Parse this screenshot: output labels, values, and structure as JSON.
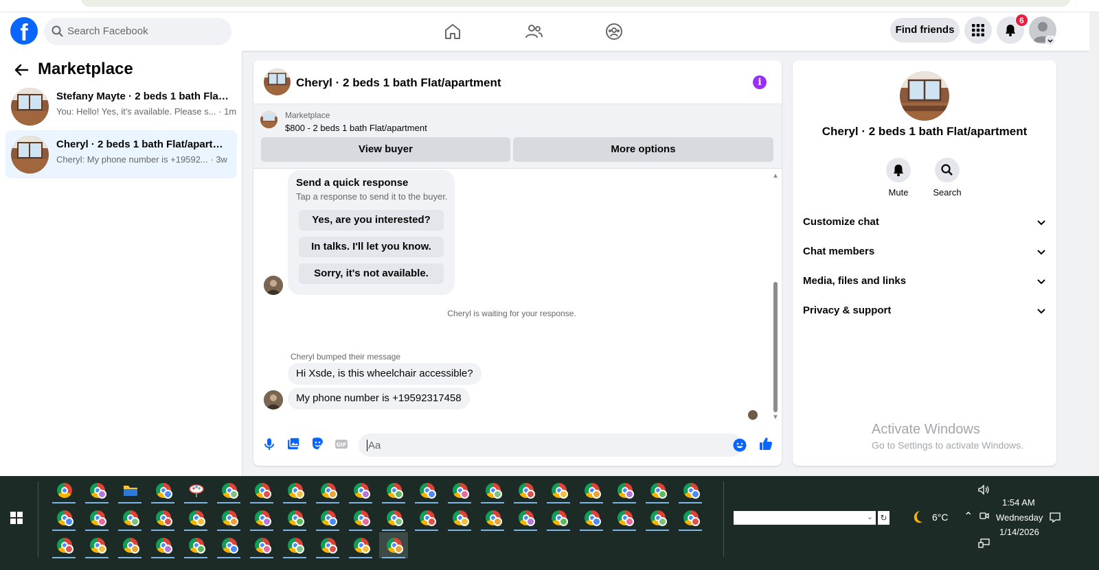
{
  "header": {
    "search_placeholder": "Search Facebook",
    "find_friends_label": "Find friends",
    "notification_count": "6",
    "fb_logo_letter": "f"
  },
  "sidebar": {
    "title": "Marketplace",
    "conversations": [
      {
        "title": "Stefany Mayte · 2 beds 1 bath Flat/...",
        "snippet": "You: Hello! Yes, it's available. Please s...",
        "time": "1m",
        "active": false
      },
      {
        "title": "Cheryl · 2 beds 1 bath Flat/apartm...",
        "snippet": "Cheryl: My phone number is +19592...",
        "time": "3w",
        "active": true
      }
    ]
  },
  "chat": {
    "title": "Cheryl · 2 beds 1 bath Flat/apartment",
    "info_glyph": "i",
    "marketplace_label": "Marketplace",
    "listing": "$800 - 2 beds 1 bath Flat/apartment",
    "view_buyer_label": "View buyer",
    "more_options_label": "More options",
    "quick_response": {
      "title": "Send a quick response",
      "subtitle": "Tap a response to send it to the buyer.",
      "options": [
        "Yes, are you interested?",
        "In talks. I'll let you know.",
        "Sorry, it's not available."
      ]
    },
    "waiting_text": "Cheryl is waiting for your response.",
    "bumped_text": "Cheryl bumped their message",
    "messages": [
      "Hi Xsde, is this wheelchair accessible?",
      "My phone number is +19592317458"
    ],
    "composer_placeholder": "Aa"
  },
  "info_panel": {
    "name": "Cheryl · 2 beds 1 bath Flat/apartment",
    "mute_label": "Mute",
    "search_label": "Search",
    "sections": [
      "Customize chat",
      "Chat members",
      "Media, files and links",
      "Privacy & support"
    ]
  },
  "watermark": {
    "line1": "Activate Windows",
    "line2": "Go to Settings to activate Windows."
  },
  "taskbar": {
    "temperature": "6°C",
    "time": "1:54 AM",
    "day": "Wednesday",
    "date": "1/14/2026"
  },
  "colors": {
    "brand_blue": "#0866ff",
    "info_purple": "#9b2ef5",
    "active_conv_bg": "#ebf5ff",
    "badge_red": "#e41e3f",
    "taskbar_bg": "#1d2b26"
  }
}
